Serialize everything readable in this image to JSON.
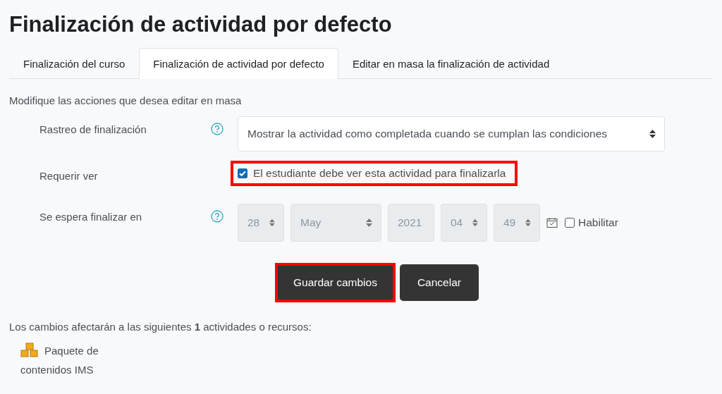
{
  "title": "Finalización de actividad por defecto",
  "tabs": [
    {
      "label": "Finalización del curso",
      "selected": false
    },
    {
      "label": "Finalización de actividad por defecto",
      "selected": true
    },
    {
      "label": "Editar en masa la finalización de actividad",
      "selected": false
    }
  ],
  "intro": "Modifique las acciones que desea editar en masa",
  "rows": [
    {
      "kind": "select",
      "label": "Rastreo de finalización",
      "help": true,
      "value": "Mostrar la actividad como completada cuando se cumplan las condiciones"
    },
    {
      "kind": "checkbox",
      "label": "Requerir ver",
      "help": false,
      "checked": true,
      "highlighted": true,
      "text": "El estudiante debe ver esta actividad para finalizarla"
    },
    {
      "kind": "date",
      "label": "Se espera finalizar en",
      "help": true,
      "parts": [
        {
          "value": "28",
          "wide": false
        },
        {
          "value": "May",
          "wide": true
        },
        {
          "value": "2021",
          "wide": false
        },
        {
          "value": "04",
          "wide": false
        },
        {
          "value": "49",
          "wide": false
        }
      ],
      "enable": {
        "label": "Habilitar",
        "checked": false
      }
    }
  ],
  "buttons": [
    {
      "label": "Guardar cambios",
      "highlighted": true
    },
    {
      "label": "Cancelar",
      "highlighted": false
    }
  ],
  "summary": "Los cambios afectarán a las siguientes **1** actividades o recursos:",
  "resources": [
    {
      "name": "Paquete de contenidos IMS"
    }
  ]
}
